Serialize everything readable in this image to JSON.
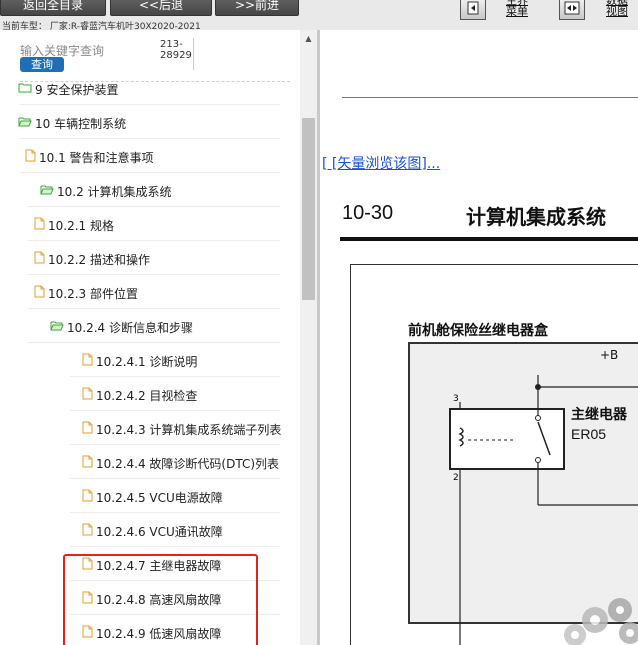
{
  "toolbar": {
    "back_to_catalog": "返回全目录",
    "prev": "<<后退",
    "next": ">>前进",
    "main_menu": "主界\n菜单",
    "data_view": "数据\n视图",
    "car_model": "当前车型： 厂家:R-睿蓝汽车机叶30X2020-2021"
  },
  "search": {
    "placeholder": "输入关键字查询",
    "button": "查询",
    "code_line1": "213-",
    "code_line2": "28929"
  },
  "tree": {
    "items": [
      {
        "label": "9 安全保护装置",
        "type": "folder-closed"
      },
      {
        "label": "10 车辆控制系统",
        "type": "folder-open"
      },
      {
        "label": "10.1 警告和注意事项",
        "type": "doc"
      },
      {
        "label": "10.2 计算机集成系统",
        "type": "folder-open"
      },
      {
        "label": "10.2.1 规格",
        "type": "doc"
      },
      {
        "label": "10.2.2 描述和操作",
        "type": "doc"
      },
      {
        "label": "10.2.3 部件位置",
        "type": "doc"
      },
      {
        "label": "10.2.4 诊断信息和步骤",
        "type": "folder-open"
      },
      {
        "label": "10.2.4.1 诊断说明",
        "type": "doc"
      },
      {
        "label": "10.2.4.2 目视检查",
        "type": "doc"
      },
      {
        "label": "10.2.4.3 计算机集成系统端子列表",
        "type": "doc"
      },
      {
        "label": "10.2.4.4 故障诊断代码(DTC)列表",
        "type": "doc"
      },
      {
        "label": "10.2.4.5 VCU电源故障",
        "type": "doc"
      },
      {
        "label": "10.2.4.6 VCU通讯故障",
        "type": "doc"
      },
      {
        "label": "10.2.4.7 主继电器故障",
        "type": "doc"
      },
      {
        "label": "10.2.4.8 高速风扇故障",
        "type": "doc"
      },
      {
        "label": "10.2.4.9 低速风扇故障",
        "type": "doc"
      }
    ]
  },
  "document": {
    "vector_link": "[ [矢量浏览该图]...",
    "page_number": "10-30",
    "page_title": "计算机集成系统",
    "fuse_box_label": "前机舱保险丝继电器盒",
    "power_label": "+B",
    "relay_name": "主继电器",
    "relay_code": "ER05",
    "pin_3": "3",
    "pin_2": "2"
  },
  "colors": {
    "highlight": "#e0231d",
    "link": "#1a4fd6",
    "search_button": "#1f6fb5",
    "folder": "#3aa53a",
    "doc": "#e0a030"
  }
}
